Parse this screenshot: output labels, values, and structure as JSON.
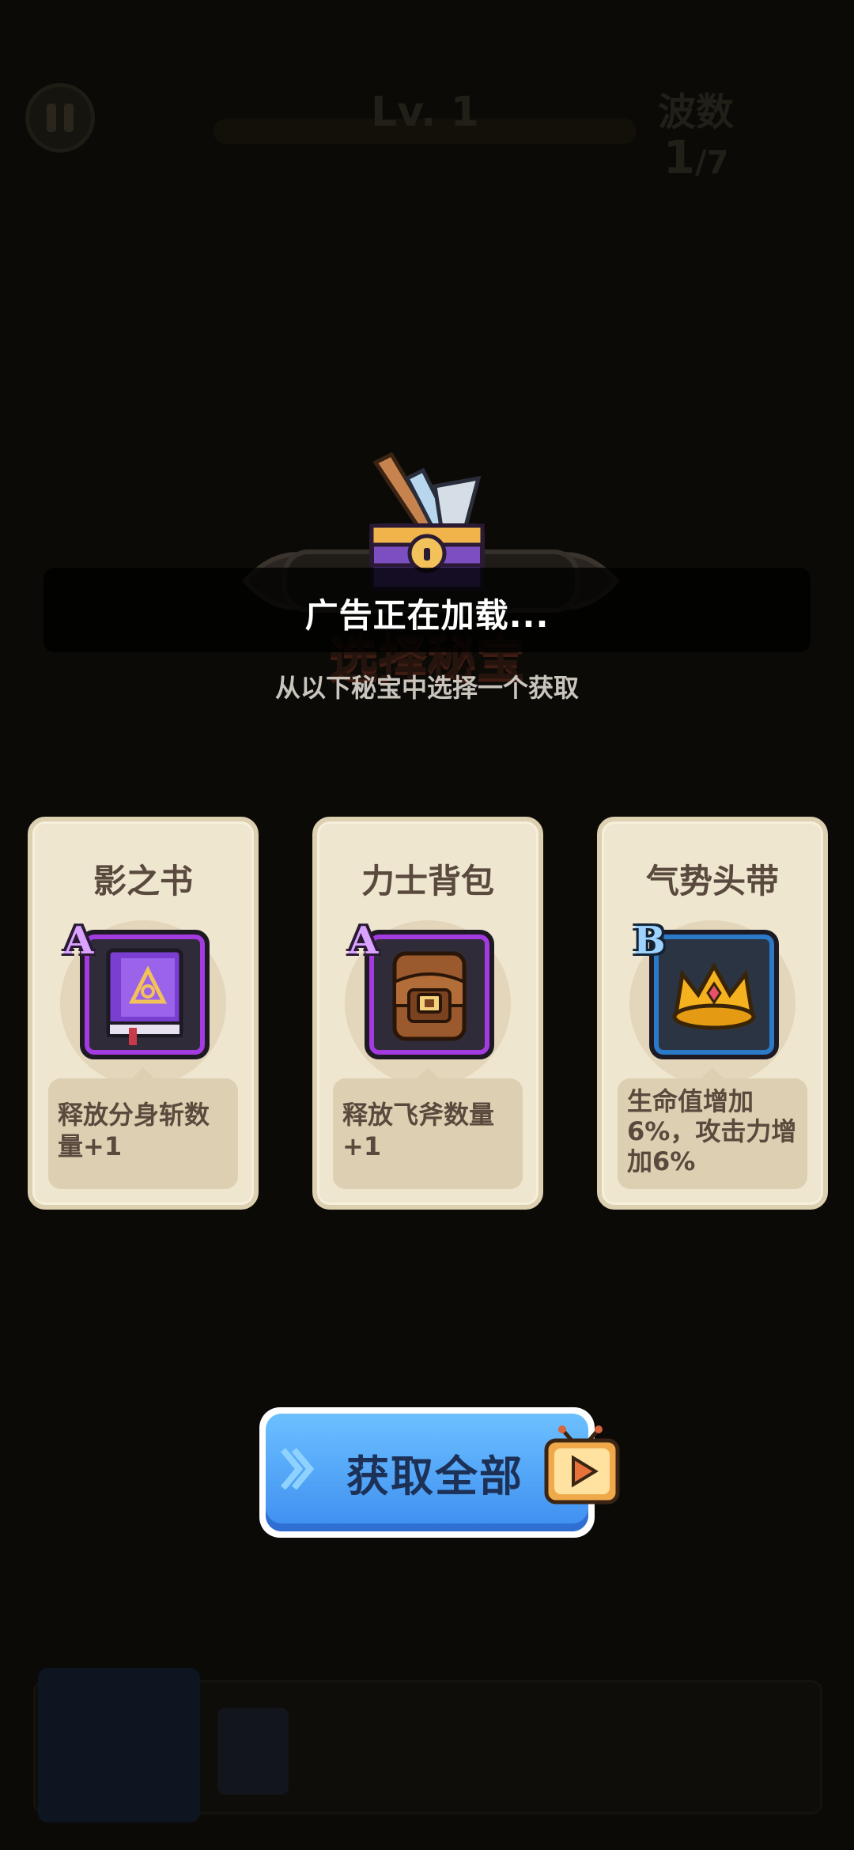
{
  "hud": {
    "level": "Lv. 1",
    "wave_label": "波数",
    "wave_current": "1",
    "wave_total": "/7"
  },
  "toast": {
    "text": "广告正在加载..."
  },
  "header": {
    "title": "选择秘宝",
    "subtitle": "从以下秘宝中选择一个获取"
  },
  "cards": [
    {
      "name": "影之书",
      "grade": "A",
      "icon": "purple-book-icon",
      "desc": "释放分身斩数量+1"
    },
    {
      "name": "力士背包",
      "grade": "A",
      "icon": "leather-backpack-icon",
      "desc": "释放飞斧数量+1"
    },
    {
      "name": "气势头带",
      "grade": "B",
      "icon": "gold-crown-icon",
      "desc": "生命值增加6%，攻击力增加6%"
    }
  ],
  "get_all_button": {
    "label": "获取全部",
    "icon": "tv-play-ad-icon"
  },
  "colors": {
    "grade_a": "#a43be0",
    "grade_b": "#2b7ac8",
    "button_blue": "#3d8ef0",
    "card_bg": "#efe6d0"
  }
}
